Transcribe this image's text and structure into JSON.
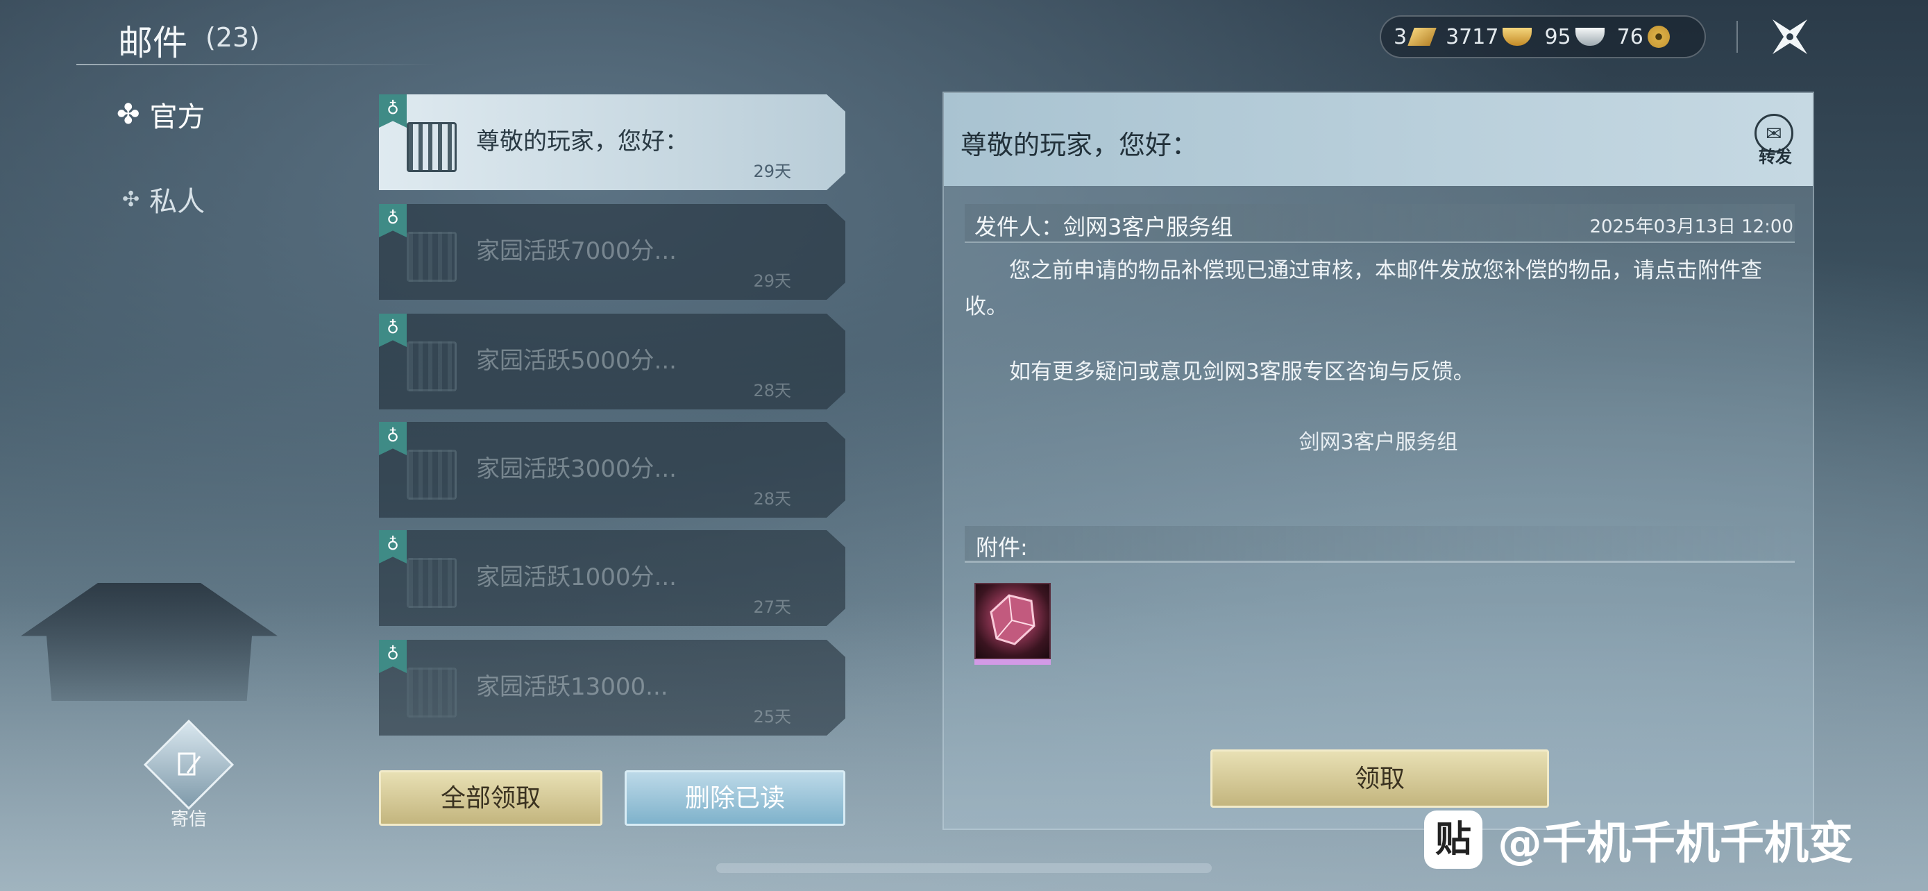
{
  "header": {
    "title": "邮件",
    "count": "(23)"
  },
  "currency": [
    {
      "value": "3",
      "icon": "gold-bar-icon"
    },
    {
      "value": "3717",
      "icon": "gold-ingot-icon"
    },
    {
      "value": "95",
      "icon": "silver-ingot-icon"
    },
    {
      "value": "76",
      "icon": "copper-coin-icon"
    }
  ],
  "nav": {
    "official": "官方",
    "private": "私人"
  },
  "write": {
    "label": "寄信"
  },
  "mails": [
    {
      "subject": "尊敬的玩家，您好：",
      "days": "29天"
    },
    {
      "subject": "家园活跃7000分...",
      "days": "29天"
    },
    {
      "subject": "家园活跃5000分...",
      "days": "28天"
    },
    {
      "subject": "家园活跃3000分...",
      "days": "28天"
    },
    {
      "subject": "家园活跃1000分...",
      "days": "27天"
    },
    {
      "subject": "家园活跃13000...",
      "days": "25天"
    }
  ],
  "list_buttons": {
    "claim_all": "全部领取",
    "delete_read": "删除已读"
  },
  "detail": {
    "title": "尊敬的玩家，您好：",
    "forward": "转发",
    "sender": "发件人：剑网3客户服务组",
    "date": "2025年03月13日  12:00",
    "paragraph1": "您之前申请的物品补偿现已通过审核，本邮件发放您补偿的物品，请点击附件查收。",
    "paragraph2": "如有更多疑问或意见剑网3客服专区咨询与反馈。",
    "signature": "剑网3客户服务组",
    "attachment_label": "附件:",
    "claim": "领取"
  },
  "watermark": {
    "logo": "贴",
    "text": "@千机千机千机变"
  },
  "colors": {
    "tag_teal": "#3f8b86",
    "gold_button": "#c3b57e",
    "blue_button": "#7fb2cb",
    "rarity_purple": "#d39ae6"
  }
}
